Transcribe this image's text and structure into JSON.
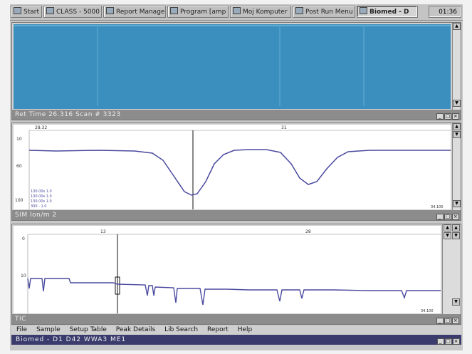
{
  "taskbar": {
    "start_label": "Start",
    "tasks": [
      {
        "label": "CLASS - 5000"
      },
      {
        "label": "Report Manager"
      },
      {
        "label": "Program [amp D"
      },
      {
        "label": "Moj Komputer"
      },
      {
        "label": "Post Run Menu"
      },
      {
        "label": "Biomed - D",
        "active": true
      }
    ],
    "clock": "01:36"
  },
  "pane_top": {
    "status": "Ret Time  26.316    Scan #  3323",
    "bg_color": "#3a8fbf"
  },
  "pane_mid": {
    "status": "SIM   Ion/m   2",
    "x_labels": [
      "28.32",
      "31"
    ],
    "y_labels": [
      "10",
      "60",
      "100"
    ],
    "corner_value": "34.100",
    "legend": [
      "130.00s  1.0",
      "130.00s  1.0",
      "130.00s  1.0",
      "300 -  1.0"
    ],
    "line_color": "#4a4aa0"
  },
  "pane_bottom": {
    "status": "TIC",
    "x_labels": [
      "13",
      "28"
    ],
    "y_labels": [
      "0",
      "10"
    ],
    "corner_value": "34.100",
    "line_color": "#4a4aa0"
  },
  "menu": {
    "items": [
      "File",
      "Sample",
      "Setup Table",
      "Peak Details",
      "Lib Search",
      "Report",
      "Help"
    ]
  },
  "window_title": "Biomed -  D1 D42  WWA3 ME1"
}
